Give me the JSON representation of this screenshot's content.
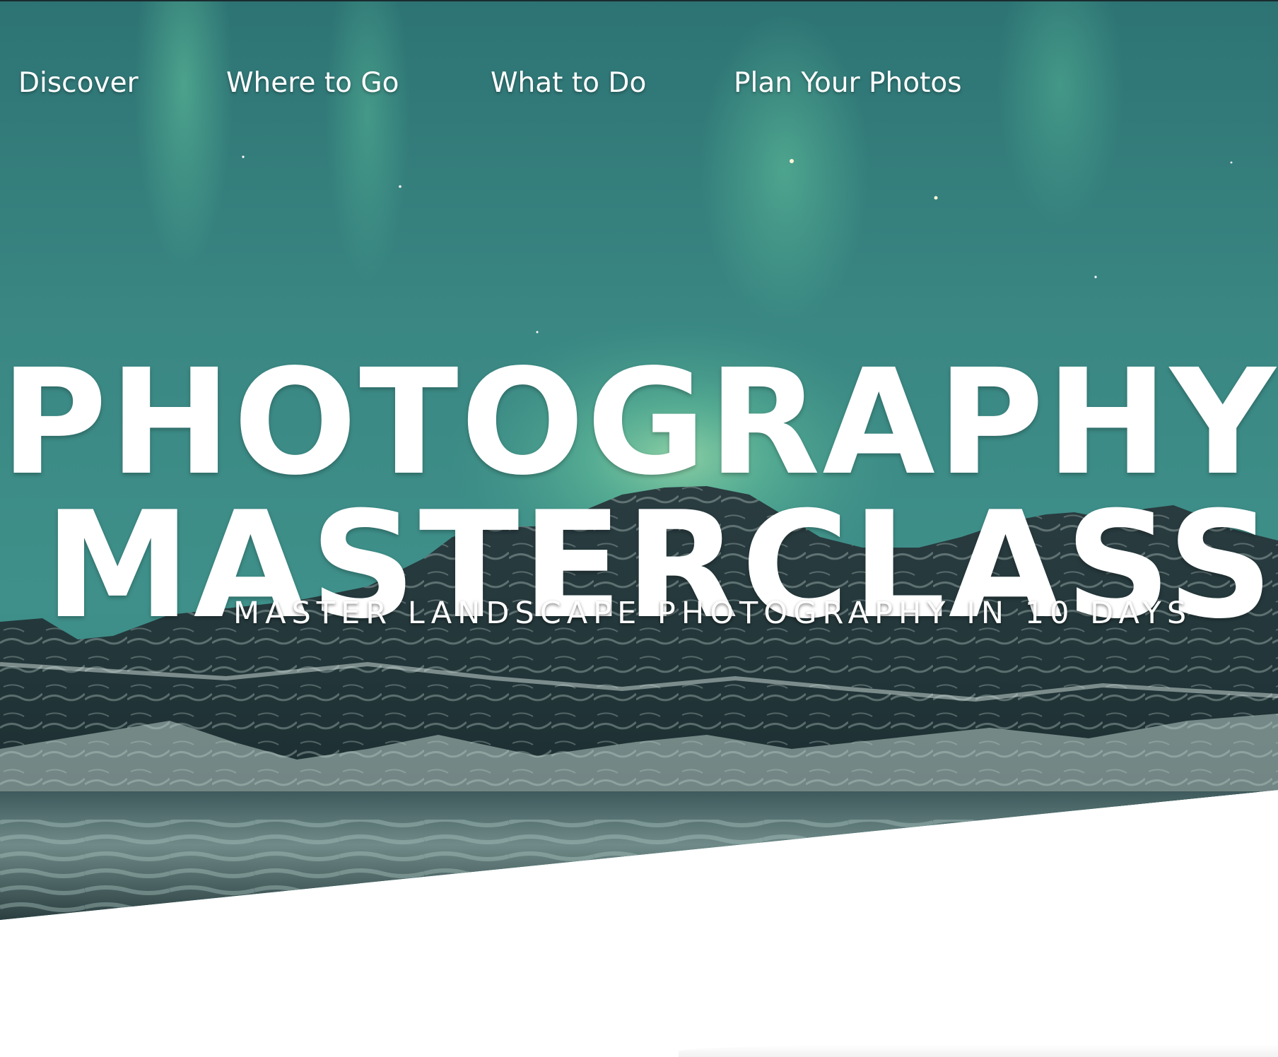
{
  "nav": {
    "items": [
      {
        "label": "Discover"
      },
      {
        "label": "Where to Go"
      },
      {
        "label": "What to Do"
      },
      {
        "label": "Plan Your Photos"
      }
    ]
  },
  "hero": {
    "title_line_1": "PHOTOGRAPHY",
    "title_line_2": "MASTERCLASS",
    "subtitle": "MASTER LANDSCAPE PHOTOGRAPHY IN 10 DAYS",
    "image_description": "aurora-over-snowy-mountains"
  },
  "colors": {
    "sky_teal": "#3e8b87",
    "aurora_green": "#5fc39a",
    "mountain_dark": "#1f3236",
    "snow": "#c9dcd8",
    "text": "#ffffff",
    "page_bg": "#ffffff"
  }
}
